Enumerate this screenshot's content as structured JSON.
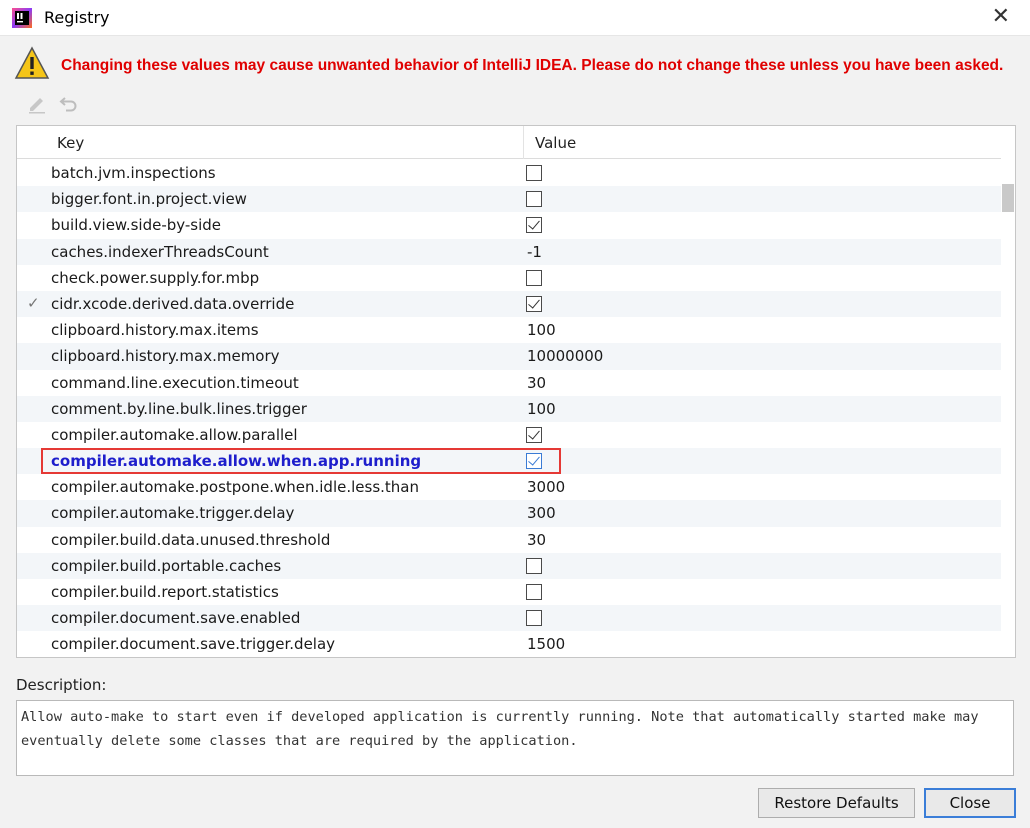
{
  "window": {
    "title": "Registry",
    "close_glyph": "✕"
  },
  "warning": {
    "icon": "warning-triangle-icon",
    "text": "Changing these values may cause unwanted behavior of IntelliJ IDEA. Please do not change these unless you have been asked."
  },
  "toolbar": {
    "icons": [
      "edit-icon",
      "revert-icon"
    ]
  },
  "table": {
    "columns": {
      "key": "Key",
      "value": "Value"
    },
    "rows": [
      {
        "key": "batch.jvm.inspections",
        "type": "checkbox",
        "checked": false,
        "mark": ""
      },
      {
        "key": "bigger.font.in.project.view",
        "type": "checkbox",
        "checked": false,
        "mark": ""
      },
      {
        "key": "build.view.side-by-side",
        "type": "checkbox",
        "checked": true,
        "mark": ""
      },
      {
        "key": "caches.indexerThreadsCount",
        "type": "text",
        "value": "-1",
        "mark": ""
      },
      {
        "key": "check.power.supply.for.mbp",
        "type": "checkbox",
        "checked": false,
        "mark": ""
      },
      {
        "key": "cidr.xcode.derived.data.override",
        "type": "checkbox",
        "checked": true,
        "mark": "✓"
      },
      {
        "key": "clipboard.history.max.items",
        "type": "text",
        "value": "100",
        "mark": ""
      },
      {
        "key": "clipboard.history.max.memory",
        "type": "text",
        "value": "10000000",
        "mark": ""
      },
      {
        "key": "command.line.execution.timeout",
        "type": "text",
        "value": "30",
        "mark": ""
      },
      {
        "key": "comment.by.line.bulk.lines.trigger",
        "type": "text",
        "value": "100",
        "mark": ""
      },
      {
        "key": "compiler.automake.allow.parallel",
        "type": "checkbox",
        "checked": true,
        "mark": ""
      },
      {
        "key": "compiler.automake.allow.when.app.running",
        "type": "checkbox",
        "checked": true,
        "mark": "",
        "modified": true
      },
      {
        "key": "compiler.automake.postpone.when.idle.less.than",
        "type": "text",
        "value": "3000",
        "mark": ""
      },
      {
        "key": "compiler.automake.trigger.delay",
        "type": "text",
        "value": "300",
        "mark": ""
      },
      {
        "key": "compiler.build.data.unused.threshold",
        "type": "text",
        "value": "30",
        "mark": ""
      },
      {
        "key": "compiler.build.portable.caches",
        "type": "checkbox",
        "checked": false,
        "mark": ""
      },
      {
        "key": "compiler.build.report.statistics",
        "type": "checkbox",
        "checked": false,
        "mark": ""
      },
      {
        "key": "compiler.document.save.enabled",
        "type": "checkbox",
        "checked": false,
        "mark": ""
      },
      {
        "key": "compiler.document.save.trigger.delay",
        "type": "text",
        "value": "1500",
        "mark": ""
      }
    ]
  },
  "description": {
    "label": "Description:",
    "text": "Allow auto-make to start even if developed application is currently running. Note that automatically started make may eventually delete some classes that are required by the application."
  },
  "buttons": {
    "restore": "Restore Defaults",
    "close": "Close"
  },
  "colors": {
    "warning": "#e00000",
    "modified_key": "#1e1ecc",
    "highlight_border": "#e53935",
    "default_button_border": "#3b7ed8"
  }
}
